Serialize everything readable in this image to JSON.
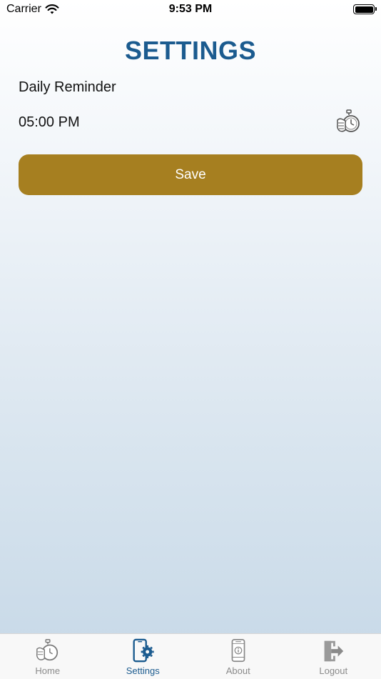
{
  "status_bar": {
    "carrier": "Carrier",
    "time": "9:53 PM"
  },
  "page": {
    "title": "SETTINGS"
  },
  "reminder": {
    "label": "Daily Reminder",
    "time": "05:00 PM",
    "icon": "stopwatch-icon"
  },
  "actions": {
    "save_label": "Save"
  },
  "tab_bar": {
    "tabs": [
      {
        "label": "Home",
        "icon": "stopwatch-icon",
        "active": false
      },
      {
        "label": "Settings",
        "icon": "phone-gear-icon",
        "active": true
      },
      {
        "label": "About",
        "icon": "phone-info-icon",
        "active": false
      },
      {
        "label": "Logout",
        "icon": "logout-icon",
        "active": false
      }
    ]
  },
  "colors": {
    "title": "#1b5b8f",
    "save_button": "#a67f20",
    "active_tab": "#1b5b8f",
    "inactive_tab": "#8a8a8a"
  }
}
